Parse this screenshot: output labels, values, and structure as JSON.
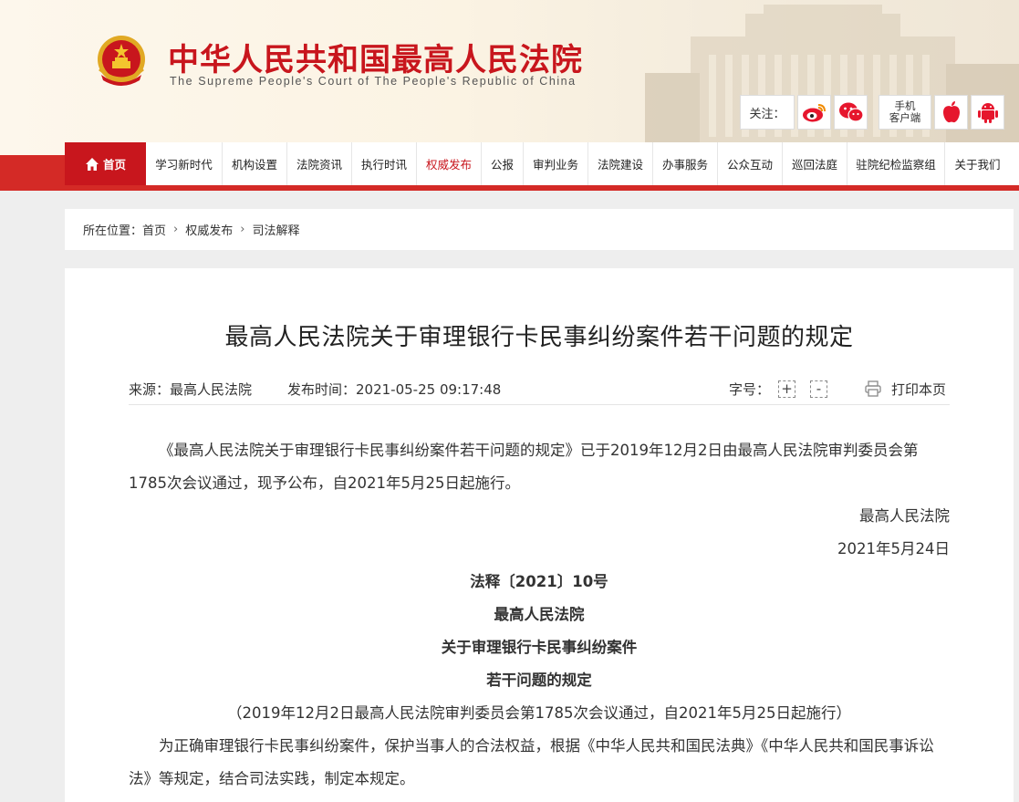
{
  "header": {
    "title": "中华人民共和国最高人民法院",
    "subtitle": "The Supreme People's Court of The People's Republic of China",
    "follow_label": "关注：",
    "follow_icons": [
      "weibo-icon",
      "wechat-icon"
    ],
    "mobile_client_line1": "手机",
    "mobile_client_line2": "客户端",
    "app_icons": [
      "apple-icon",
      "android-icon"
    ]
  },
  "nav": {
    "items": [
      {
        "label": "首页"
      },
      {
        "label": "学习新时代"
      },
      {
        "label": "机构设置"
      },
      {
        "label": "法院资讯"
      },
      {
        "label": "执行时讯"
      },
      {
        "label": "权威发布"
      },
      {
        "label": "公报"
      },
      {
        "label": "审判业务"
      },
      {
        "label": "法院建设"
      },
      {
        "label": "办事服务"
      },
      {
        "label": "公众互动"
      },
      {
        "label": "巡回法庭"
      },
      {
        "label": "驻院纪检监察组"
      },
      {
        "label": "关于我们"
      }
    ],
    "active_index": 5
  },
  "breadcrumb": {
    "prefix": "所在位置：",
    "items": [
      "首页",
      "权威发布",
      "司法解释"
    ],
    "separator": "›"
  },
  "article": {
    "title": "最高人民法院关于审理银行卡民事纠纷案件若干问题的规定",
    "source": "来源：最高人民法院",
    "publish_time": "发布时间：2021-05-25 09:17:48",
    "font_size_label": "字号：",
    "font_increase": "+",
    "font_decrease": "-",
    "print_label": "打印本页",
    "intro": "《最高人民法院关于审理银行卡民事纠纷案件若干问题的规定》已于2019年12月2日由最高人民法院审判委员会第1785次会议通过，现予公布，自2021年5月25日起施行。",
    "sign_court": "最高人民法院",
    "sign_date": "2021年5月24日",
    "doc_number": "法释〔2021〕10号",
    "heading1": "最高人民法院",
    "heading2": "关于审理银行卡民事纠纷案件",
    "heading3": "若干问题的规定",
    "adoption_note": "（2019年12月2日最高人民法院审判委员会第1785次会议通过，自2021年5月25日起施行）",
    "preamble": "为正确审理银行卡民事纠纷案件，保护当事人的合法权益，根据《中华人民共和国民法典》《中华人民共和国民事诉讼法》等规定，结合司法实践，制定本规定。"
  },
  "colors": {
    "brand_red": "#c8161d",
    "nav_strip": "#d42a26",
    "page_bg": "#eeeeee"
  }
}
